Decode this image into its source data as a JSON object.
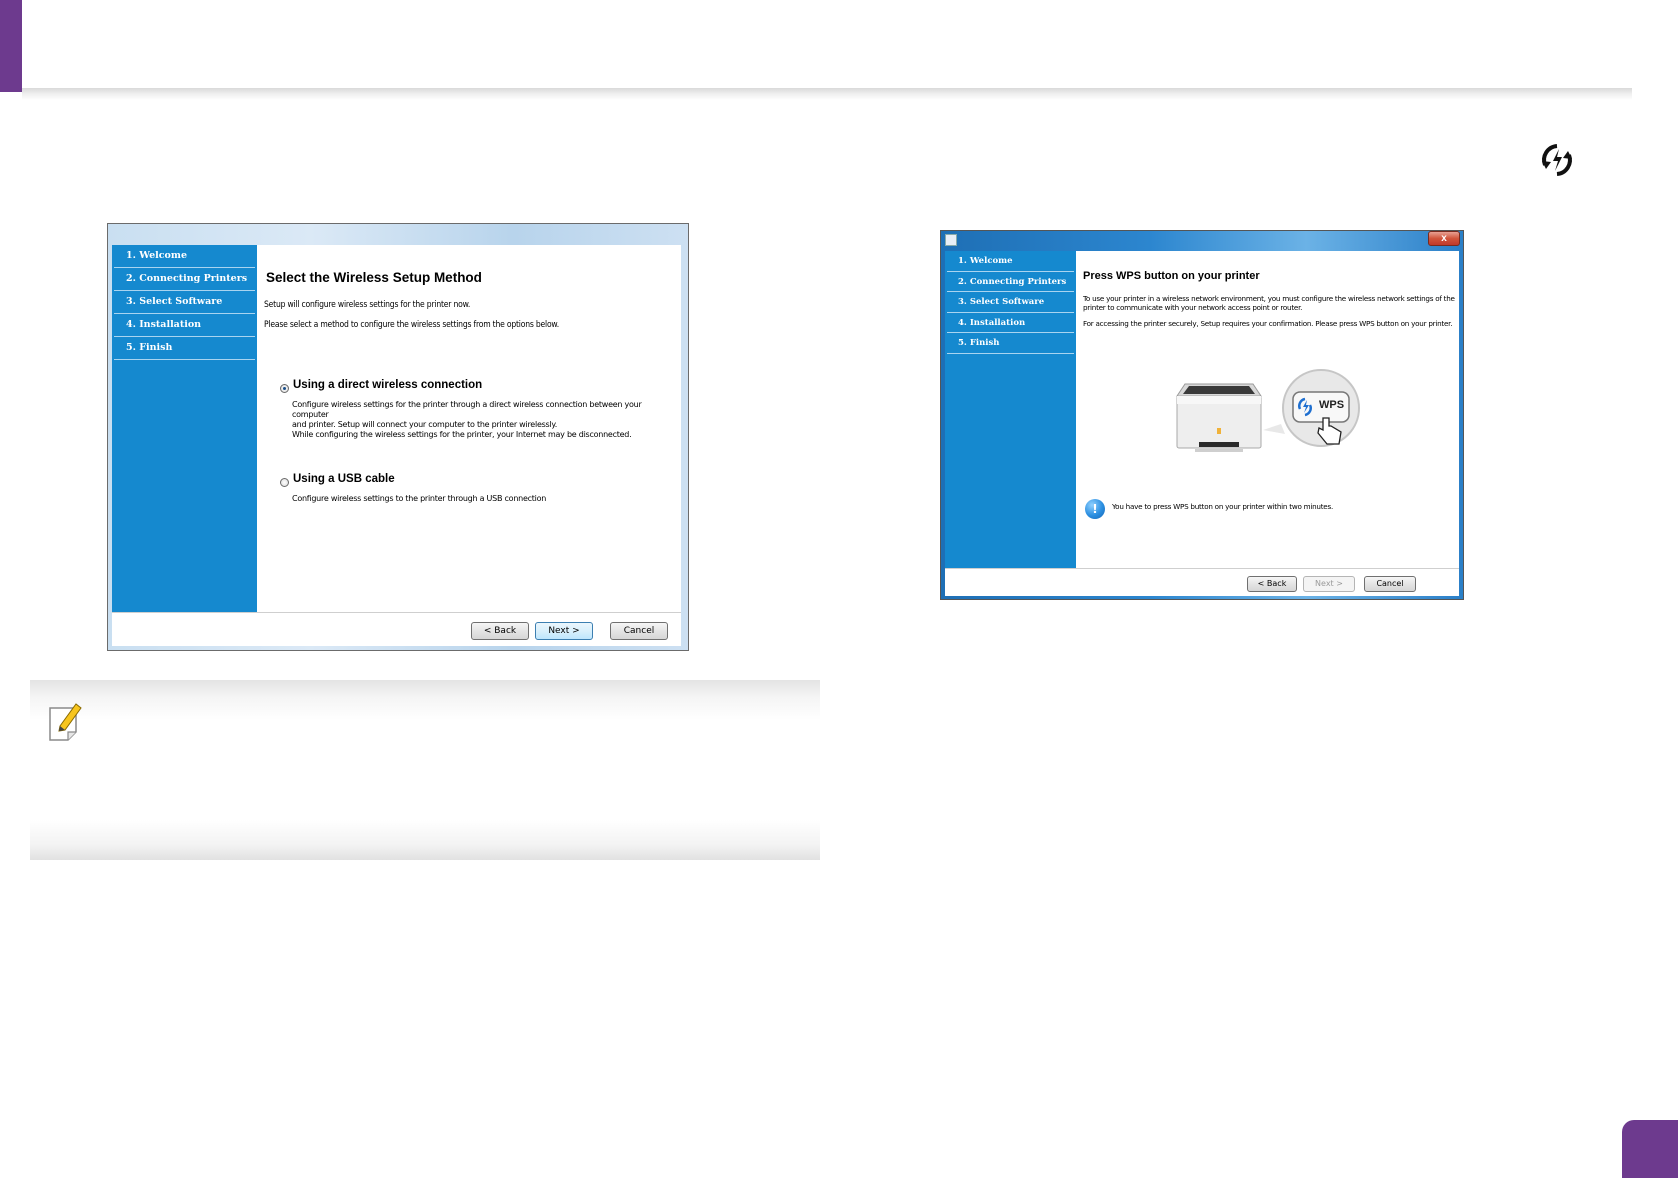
{
  "wizard_steps": [
    "1. Welcome",
    "2. Connecting Printers",
    "3. Select Software",
    "4. Installation",
    "5. Finish"
  ],
  "window1": {
    "heading": "Select the Wireless Setup Method",
    "intro": "Setup will configure wireless settings for the printer now.",
    "instruction": "Please select a method to configure the wireless settings from the options below.",
    "option_direct": {
      "label": "Using a direct wireless connection",
      "selected": true,
      "desc_line1": "Configure wireless settings for the printer through a direct wireless connection between your computer",
      "desc_line2": "and printer. Setup will connect your computer to the printer wirelessly.",
      "desc_line3": "While configuring the wireless settings for the printer, your Internet may be disconnected."
    },
    "option_usb": {
      "label": "Using a USB cable",
      "selected": false,
      "desc": "Configure wireless settings to the printer through a USB connection"
    },
    "buttons": {
      "back": "< Back",
      "next": "Next >",
      "cancel": "Cancel"
    }
  },
  "window2": {
    "close_glyph": "x",
    "heading": "Press WPS button on your printer",
    "para1_line1": "To use your printer in a wireless network environment, you must configure the wireless network settings of the",
    "para1_line2": "printer to communicate with your network access point or router.",
    "para2": "For accessing the printer securely, Setup requires your confirmation. Please press WPS button on your printer.",
    "wps_label": "WPS",
    "info_glyph": "!",
    "info": "You have to press WPS button on your printer within two minutes.",
    "buttons": {
      "back": "< Back",
      "next": "Next >",
      "next_enabled": false,
      "cancel": "Cancel"
    }
  },
  "colors": {
    "accent": "#6d3a8e",
    "stepper": "#1589cf"
  }
}
